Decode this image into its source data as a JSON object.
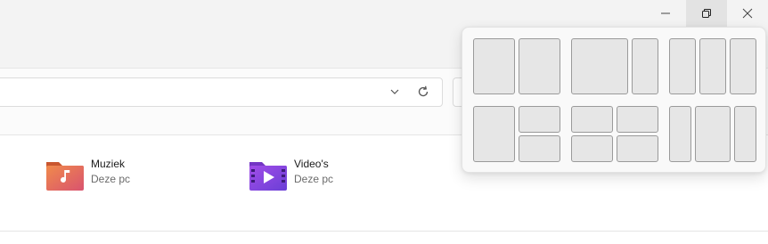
{
  "window": {
    "controls": {
      "minimize": "minimize-icon",
      "restore": "restore-icon",
      "close": "close-icon"
    }
  },
  "toolbar": {
    "address_dropdown_icon": "chevron-down-icon",
    "refresh_icon": "refresh-icon"
  },
  "items": [
    {
      "name": "Muziek",
      "location": "Deze pc",
      "icon": "music-folder-icon"
    },
    {
      "name": "Video's",
      "location": "Deze pc",
      "icon": "videos-folder-icon"
    }
  ],
  "snap_layouts": {
    "layouts": [
      {
        "name": "two-halves",
        "zones": 2
      },
      {
        "name": "two-thirds-one-third",
        "zones": 2
      },
      {
        "name": "three-columns",
        "zones": 3
      },
      {
        "name": "half-and-two-quarters",
        "zones": 3
      },
      {
        "name": "four-quadrants",
        "zones": 4
      },
      {
        "name": "three-columns-wide-center",
        "zones": 3
      }
    ]
  },
  "colors": {
    "titlebar": "#f3f3f3",
    "music_folder": "#e8725a",
    "videos_folder": "#8a4fe0",
    "snap_zone": "#e6e6e6"
  }
}
